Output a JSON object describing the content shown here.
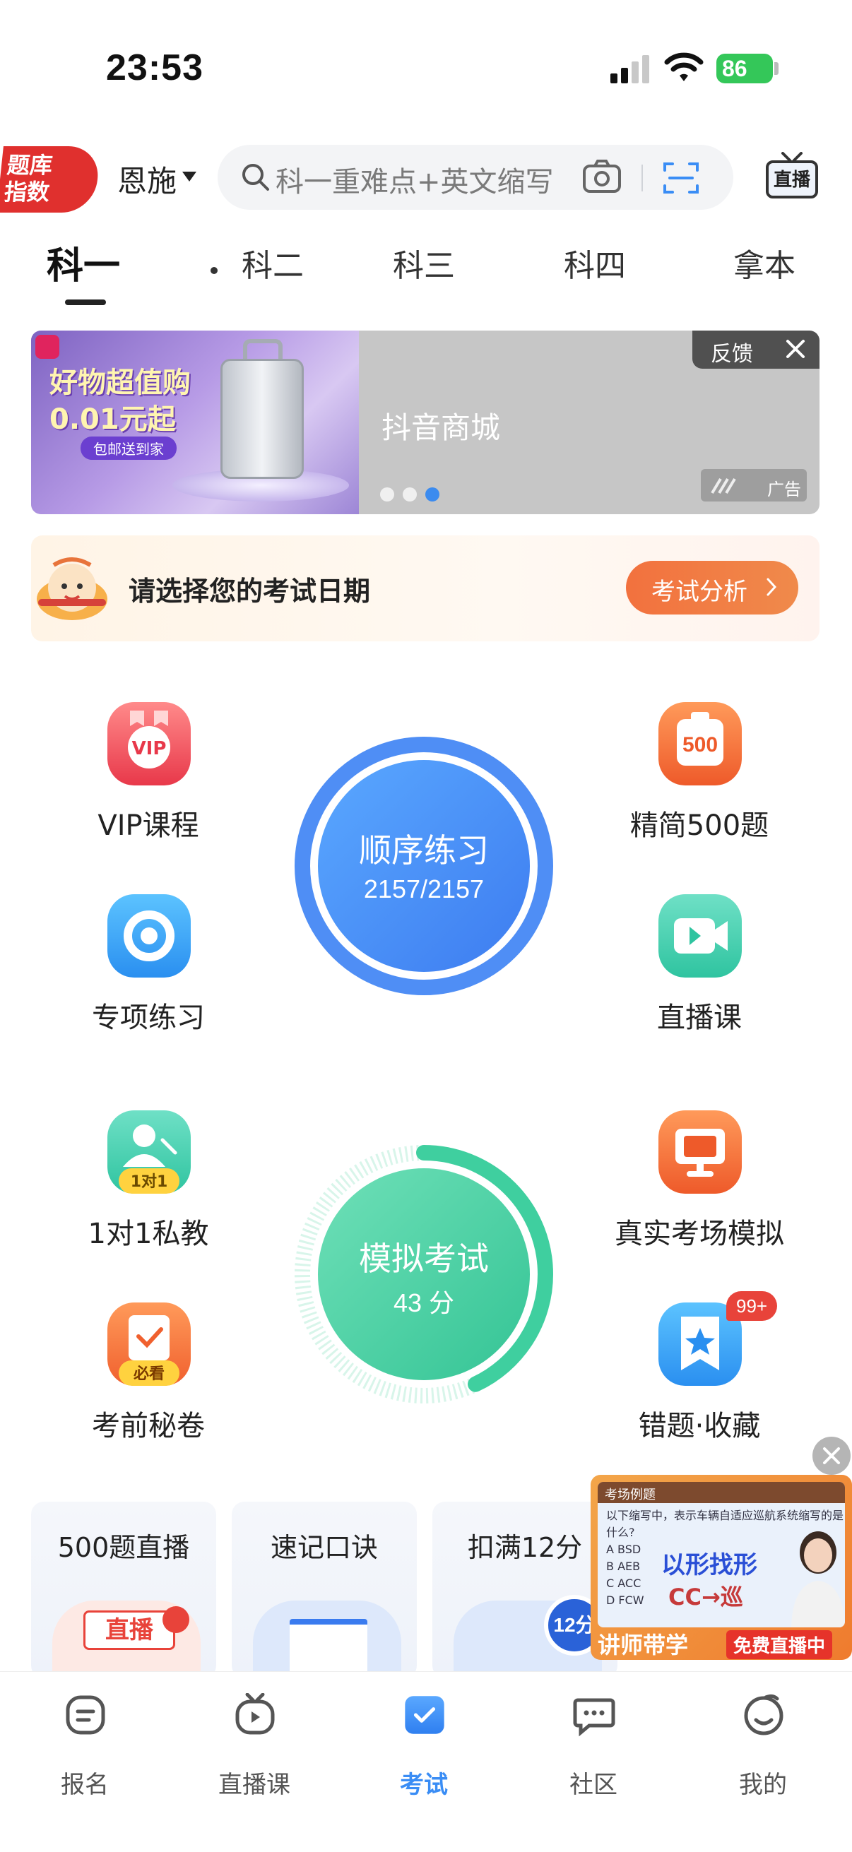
{
  "status_bar": {
    "time": "23:53",
    "battery": "86"
  },
  "header": {
    "logo_text": "题库\n指数",
    "city": "恩施",
    "search_placeholder": "科一重难点+英文缩写",
    "live_label": "直播"
  },
  "subject_tabs": [
    {
      "label": "科一",
      "active": true
    },
    {
      "label": "科二",
      "active": false
    },
    {
      "label": "科三",
      "active": false
    },
    {
      "label": "科四",
      "active": false
    },
    {
      "label": "拿本",
      "active": false
    }
  ],
  "banner": {
    "headline_line1": "好物超值购",
    "headline_line2": "0.01元起",
    "pill": "包邮送到家",
    "store": "抖音商城",
    "feedback": "反馈",
    "ad_tag": "广告",
    "dots_count": 3,
    "active_dot": 2
  },
  "exam_date": {
    "prompt": "请选择您的考试日期",
    "button": "考试分析"
  },
  "features": {
    "vip": "VIP课程",
    "vip_icon": "VIP",
    "special": "专项练习",
    "jingjian": "精简500题",
    "jingjian_icon": "500",
    "live_course": "直播课",
    "one_on_one": "1对1私教",
    "one_on_one_icon": "1对1",
    "real_exam": "真实考场模拟",
    "secret": "考前秘卷",
    "secret_icon": "必看",
    "wrong": "错题·收藏",
    "wrong_badge": "99+"
  },
  "practice_ring": {
    "title": "顺序练习",
    "progress": "2157/2157",
    "fraction": 1.0,
    "color": "#4f8ef5"
  },
  "mock_ring": {
    "title": "模拟考试",
    "score": "43 分",
    "fraction": 0.43,
    "color": "#3fcf9f"
  },
  "bottom_cards": [
    {
      "title": "500题直播",
      "art": "直播"
    },
    {
      "title": "速记口诀",
      "art": ""
    },
    {
      "title": "扣满12分",
      "art": "12分"
    }
  ],
  "video_card": {
    "head": "考场例题",
    "lines": [
      "以下缩写中，表示车辆自适应巡航系统缩写的是",
      "什么?",
      "A  BSD",
      "B  AEB",
      "C  ACC",
      "D  FCW"
    ],
    "big1": "以形找形",
    "big2": "CC→巡",
    "foot_left": "讲师带学",
    "foot_right": "免费直播中"
  },
  "bottom_nav": [
    {
      "label": "报名",
      "icon": "register-icon",
      "active": false
    },
    {
      "label": "直播课",
      "icon": "live-course-icon",
      "active": false
    },
    {
      "label": "考试",
      "icon": "exam-icon",
      "active": true
    },
    {
      "label": "社区",
      "icon": "community-icon",
      "active": false
    },
    {
      "label": "我的",
      "icon": "profile-icon",
      "active": false
    }
  ],
  "colors": {
    "accent": "#3a8df5",
    "orange": "#f2713e",
    "red": "#e0302e",
    "green": "#3fcf9f"
  }
}
